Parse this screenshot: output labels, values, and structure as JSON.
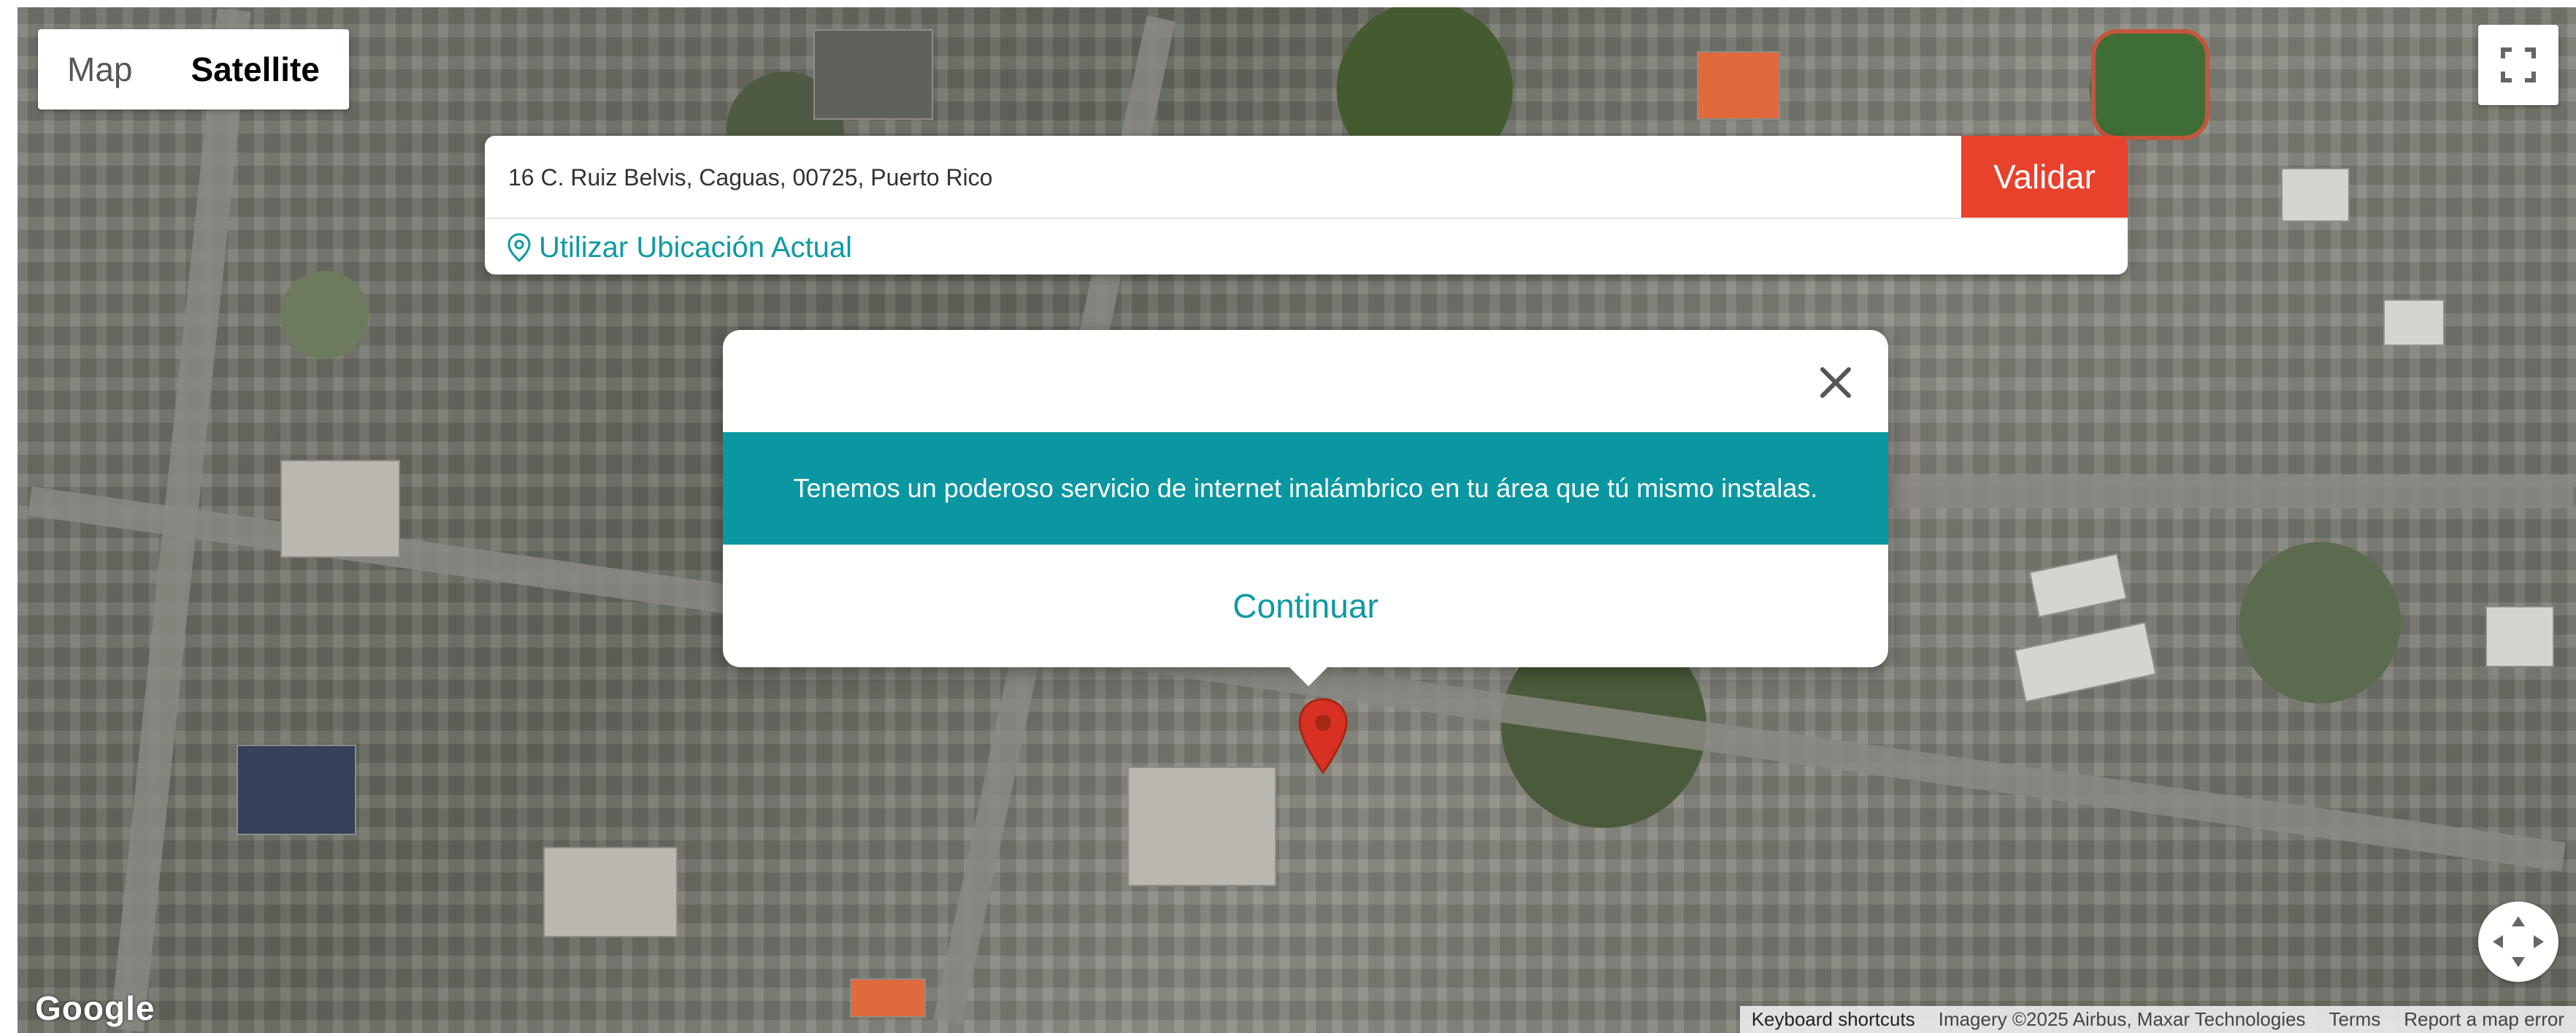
{
  "map_type": {
    "map_label": "Map",
    "satellite_label": "Satellite",
    "selected": "Satellite"
  },
  "search": {
    "address_value": "16 C. Ruiz Belvis, Caguas, 00725, Puerto Rico",
    "validate_label": "Validar",
    "use_location_label": "Utilizar Ubicación Actual"
  },
  "dialog": {
    "message": "Tenemos un poderoso servicio de internet inalámbrico en tu área que tú mismo instalas.",
    "continue_label": "Continuar"
  },
  "map_footer": {
    "google": "Google",
    "keyboard_shortcuts": "Keyboard shortcuts",
    "imagery": "Imagery ©2025 Airbus, Maxar Technologies",
    "terms": "Terms",
    "report": "Report a map error"
  },
  "colors": {
    "accent_teal": "#0b97a1",
    "validate_red": "#e8412c",
    "pin_red": "#d93025"
  },
  "icons": [
    "fullscreen-icon",
    "location-pin-icon",
    "close-icon",
    "map-marker-icon",
    "recenter-icon"
  ]
}
